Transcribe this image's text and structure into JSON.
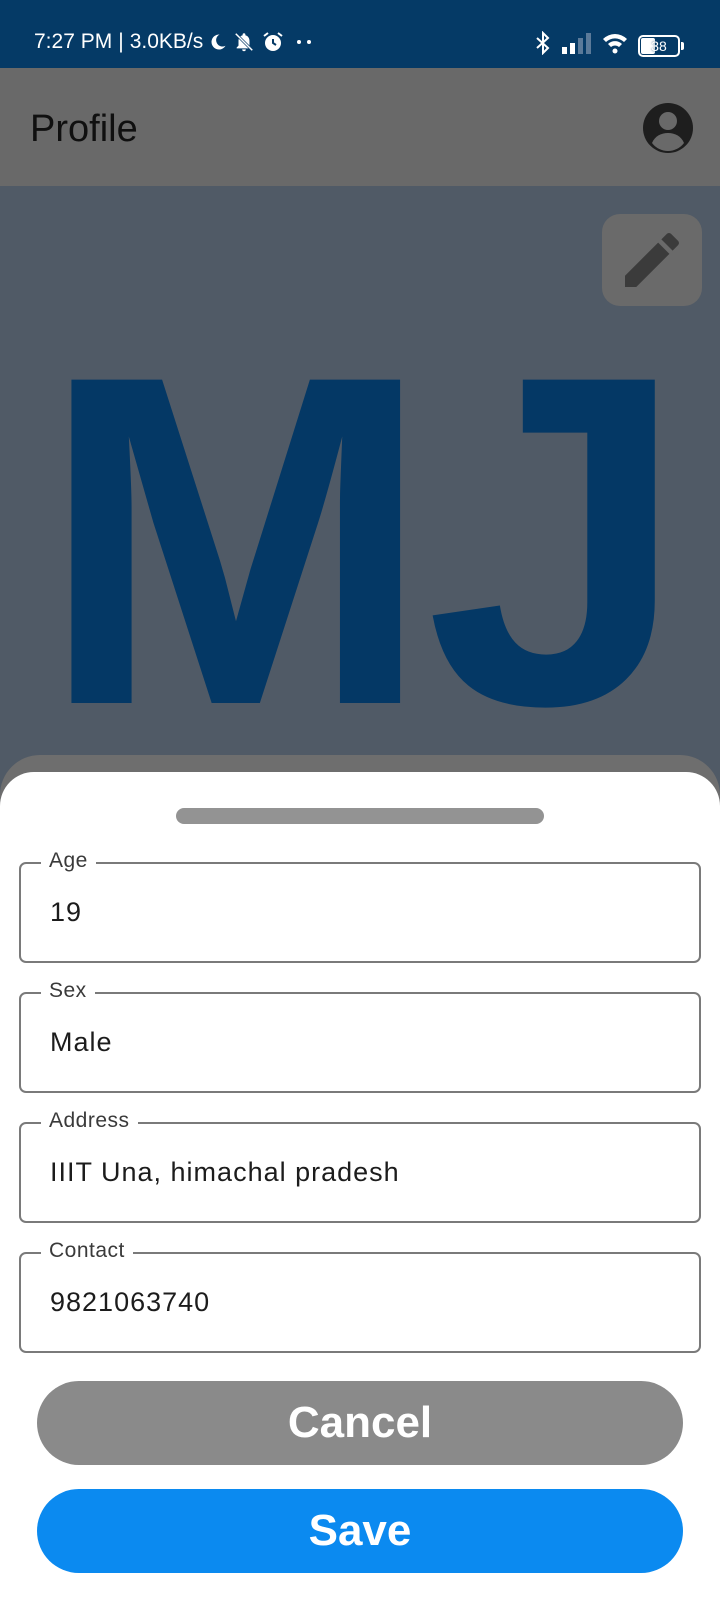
{
  "status_bar": {
    "time": "7:27 PM",
    "speed": "3.0KB/s",
    "battery": "38",
    "icons": [
      "moon-icon",
      "notifications-off-icon",
      "alarm-icon",
      "more-dots-icon",
      "bluetooth-icon",
      "cellular-signal-icon",
      "wifi-icon",
      "battery-icon"
    ]
  },
  "app_bar": {
    "title": "Profile",
    "account_icon": "account-circle-icon"
  },
  "profile": {
    "initials": "MJ",
    "edit_icon": "pencil-icon"
  },
  "form": {
    "fields": [
      {
        "label": "Age",
        "value": "19"
      },
      {
        "label": "Sex",
        "value": "Male"
      },
      {
        "label": "Address",
        "value": "IIIT Una, himachal pradesh"
      },
      {
        "label": "Contact",
        "value": "9821063740"
      }
    ],
    "cancel_label": "Cancel",
    "save_label": "Save"
  },
  "colors": {
    "status_bar": "#053a66",
    "app_bar": "#696969",
    "profile_background": "#505a66",
    "initials": "#043865",
    "cancel_button": "#8a8a8a",
    "save_button": "#0b8af0"
  }
}
